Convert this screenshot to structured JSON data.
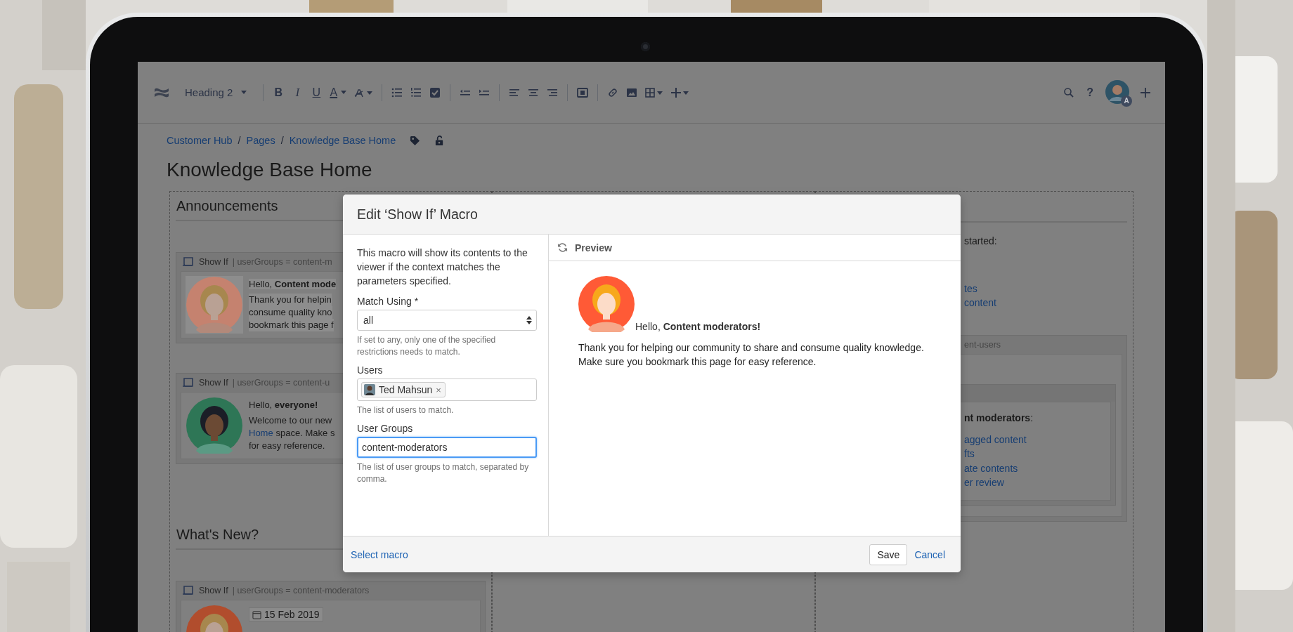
{
  "toolbar": {
    "style_menu": "Heading 2",
    "format_buttons": [
      {
        "kind": "bold",
        "label": "B"
      },
      {
        "kind": "italic",
        "label": "I"
      },
      {
        "kind": "underline",
        "label": "U"
      },
      {
        "kind": "color",
        "label": "A"
      }
    ],
    "help": "?",
    "avatar_badge": "A"
  },
  "breadcrumbs": {
    "separator": "/",
    "items": [
      "Customer Hub",
      "Pages",
      "Knowledge Base Home"
    ]
  },
  "page_title": "Knowledge Base Home",
  "left_column": {
    "sections": [
      {
        "heading": "Announcements",
        "macros": [
          {
            "title": "Show If",
            "params": "| userGroups = content-m",
            "highlighted": true,
            "avatar": {
              "kind": "blonde-dim",
              "color": "#c5826f"
            },
            "greeting": "Hello, **Content mode**",
            "lines": [
              [
                {
                  "text": "Thank you for helpin",
                  "link": false
                }
              ],
              [
                {
                  "text": "consume quality kno",
                  "link": false
                }
              ],
              [
                {
                  "text": "bookmark this page f",
                  "link": false
                }
              ]
            ]
          },
          {
            "title": "Show If",
            "params": "| userGroups = content-u",
            "highlighted": false,
            "avatar": {
              "kind": "dark-dim",
              "color": "#2e7656"
            },
            "greeting": "Hello, **everyone!**",
            "lines": [
              [
                {
                  "text": "Welcome to our new",
                  "link": false
                }
              ],
              [
                {
                  "text": "Home",
                  "link": true
                },
                {
                  "text": "space. Make s",
                  "link": false
                }
              ],
              [
                {
                  "text": "for easy reference.",
                  "link": false
                }
              ]
            ]
          }
        ]
      },
      {
        "heading": "What's New?",
        "macros": [
          {
            "title": "Show If",
            "params": "| userGroups = content-moderators",
            "highlighted": false,
            "avatar": {
              "kind": "blonde-dim",
              "color": "#b14d2d"
            },
            "date": "15 Feb 2019"
          }
        ]
      }
    ]
  },
  "right_column": {
    "intro": "started:",
    "links": [
      "tes",
      "content"
    ],
    "macro": {
      "params": "ent-users",
      "inner": {
        "heading": "**nt moderators**:",
        "links": [
          "agged content",
          "fts",
          "ate contents",
          "er review"
        ]
      }
    }
  },
  "dialog": {
    "title": "Edit ‘Show If’ Macro",
    "description": "This macro will show its contents to the viewer if the context matches the parameters specified.",
    "fields": [
      {
        "kind": "select",
        "label": "Match Using *",
        "value": "all",
        "hint": "If set to any, only one of the specified restrictions needs to match.",
        "focused": false
      },
      {
        "kind": "users",
        "label": "Users",
        "chips": [
          {
            "name": "Ted Mahsun",
            "remove": "×"
          }
        ],
        "hint": "The list of users to match.",
        "focused": false
      },
      {
        "kind": "text",
        "label": "User Groups",
        "value": "content-moderators",
        "hint": "The list of user groups to match, separated by comma.",
        "focused": true
      }
    ],
    "preview": {
      "title": "Preview",
      "avatar": {
        "kind": "blonde",
        "color": "#ff5a36"
      },
      "greeting": "Hello, **Content moderators!**",
      "body": "Thank you for helping our community to share and consume quality knowledge. Make sure you bookmark this page for easy reference."
    },
    "footer": {
      "link": "Select macro",
      "save": "Save",
      "cancel": "Cancel"
    }
  }
}
